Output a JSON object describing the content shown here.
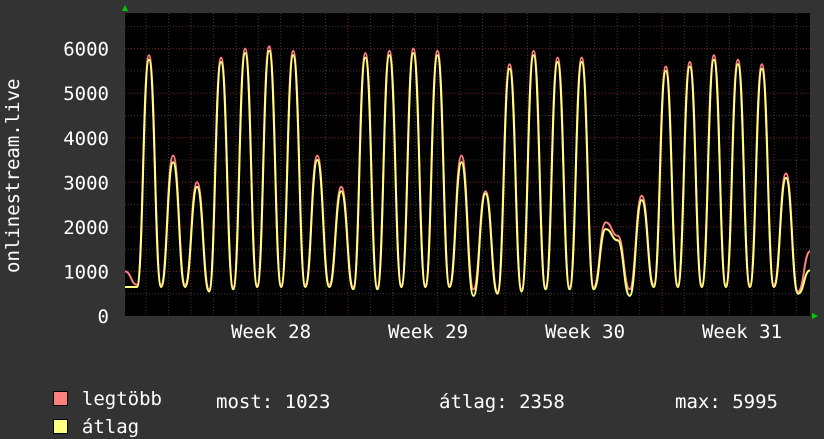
{
  "chart_data": {
    "type": "line",
    "ylabel": "onlinestream.live",
    "ylim": [
      0,
      6800
    ],
    "yticks": [
      0,
      1000,
      2000,
      3000,
      4000,
      5000,
      6000
    ],
    "x_tick_labels": [
      "Week 28",
      "Week 29",
      "Week 30",
      "Week 31"
    ],
    "grid": true,
    "background": "#000000",
    "series": [
      {
        "name": "legtöbb",
        "color": "#ff7f7f",
        "values": [
          1000,
          700,
          5850,
          700,
          3600,
          700,
          3000,
          600,
          5800,
          650,
          6000,
          700,
          6050,
          700,
          5950,
          700,
          3600,
          700,
          2900,
          650,
          5900,
          650,
          5950,
          700,
          6000,
          700,
          5950,
          700,
          3600,
          600,
          2800,
          550,
          5650,
          600,
          5950,
          650,
          5800,
          650,
          5800,
          650,
          2100,
          1800,
          600,
          2700,
          700,
          5600,
          700,
          5700,
          700,
          5850,
          700,
          5750,
          700,
          5650,
          700,
          3200,
          550,
          1450
        ]
      },
      {
        "name": "átlag",
        "color": "#ffff80",
        "values": [
          650,
          650,
          5750,
          650,
          3450,
          650,
          2900,
          550,
          5700,
          600,
          5900,
          650,
          5950,
          650,
          5850,
          650,
          3500,
          650,
          2800,
          600,
          5800,
          600,
          5850,
          650,
          5900,
          650,
          5850,
          650,
          3450,
          450,
          2750,
          500,
          5550,
          550,
          5850,
          600,
          5700,
          600,
          5700,
          600,
          1950,
          1700,
          450,
          2600,
          650,
          5500,
          650,
          5600,
          650,
          5750,
          650,
          5650,
          650,
          5550,
          650,
          3100,
          500,
          1023
        ]
      }
    ]
  },
  "legend": [
    {
      "label": "legtöbb",
      "color": "#ff7f7f"
    },
    {
      "label": "átlag",
      "color": "#ffff80"
    }
  ],
  "stats": {
    "now": "most: 1023",
    "avg": "átlag: 2358",
    "max": "max: 5995"
  }
}
